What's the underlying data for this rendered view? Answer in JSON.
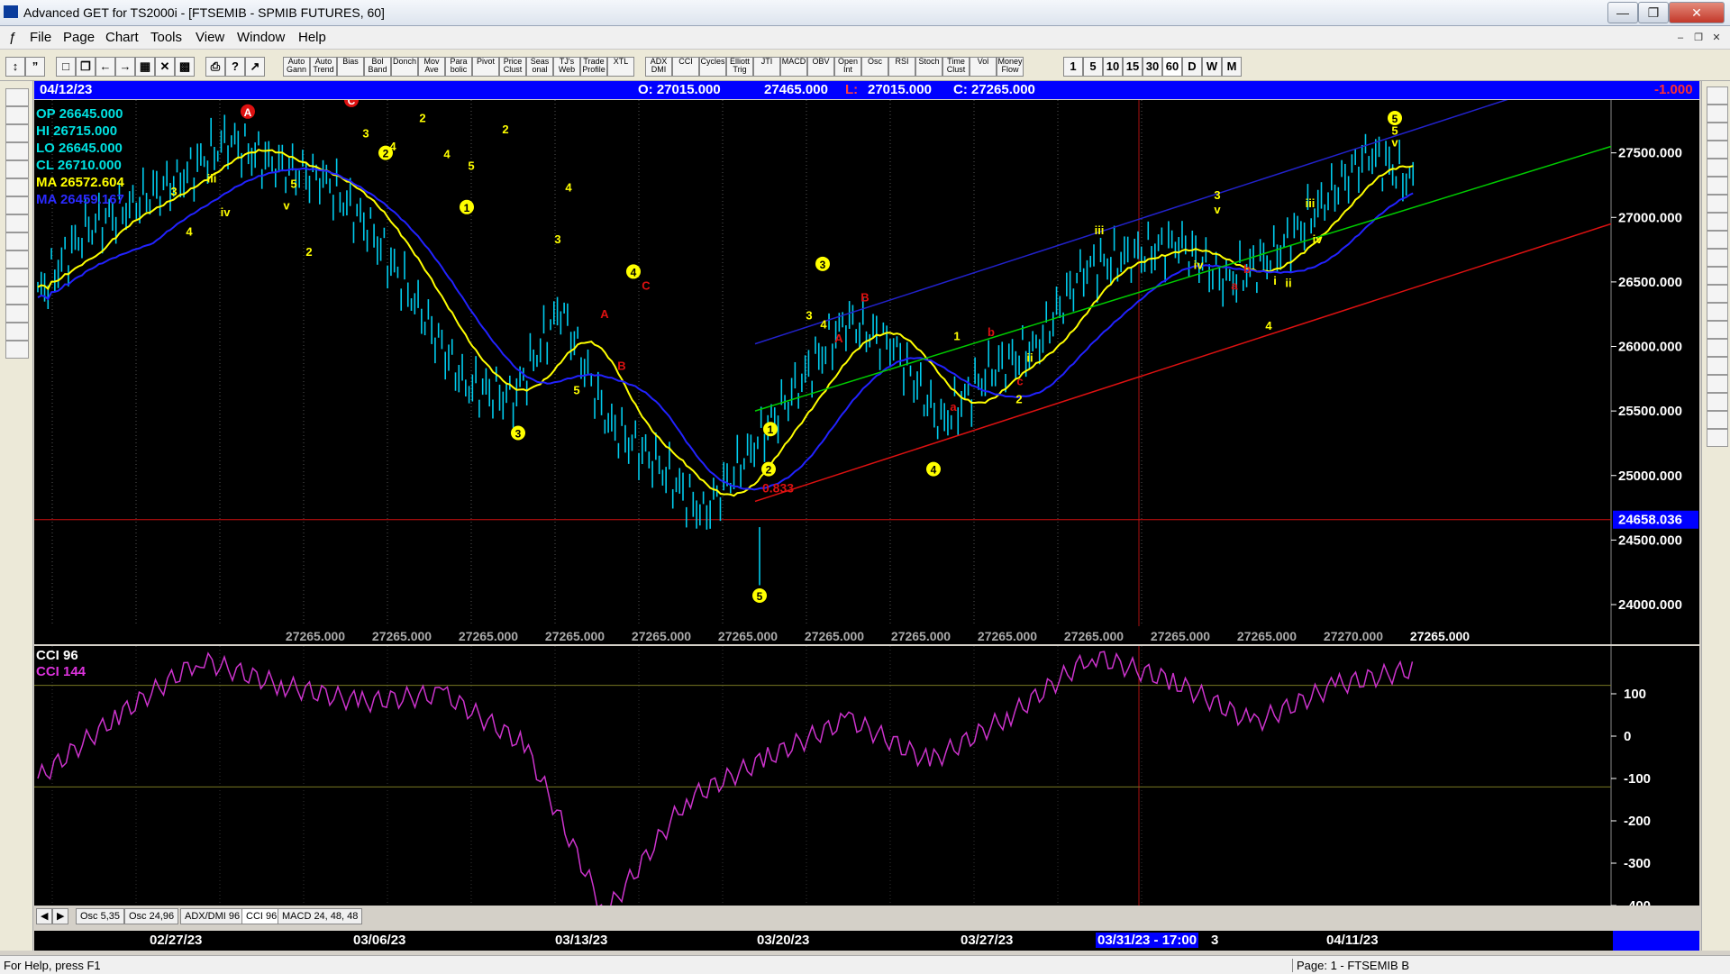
{
  "window": {
    "title": "Advanced GET for TS2000i - [FTSEMIB - SPMIB FUTURES, 60]"
  },
  "menu": [
    "File",
    "Page",
    "Chart",
    "Tools",
    "View",
    "Window",
    "Help"
  ],
  "toolbar": {
    "study_buttons": [
      "Auto Gann",
      "Auto Trend",
      "Bias",
      "Bol Band",
      "Donch",
      "Mov Ave",
      "Para bolic",
      "Pivot",
      "Price Clust",
      "Seas onal",
      "TJ's Web",
      "Trade Profile",
      "XTL",
      "ADX DMI",
      "CCI",
      "Cycles",
      "Elliott Trig",
      "JTI",
      "MACD",
      "OBV",
      "Open Int",
      "Osc",
      "RSI",
      "Stoch",
      "Time Clust",
      "Vol",
      "Money Flow"
    ],
    "intervals": [
      "1",
      "5",
      "10",
      "15",
      "30",
      "60",
      "D",
      "W",
      "M"
    ]
  },
  "chart_header": {
    "date": "04/12/23",
    "open": "O: 27015.000",
    "high": "27465.000",
    "low_label": "L:",
    "low": "27015.000",
    "close": "C: 27265.000",
    "change": "-1.000"
  },
  "ohlc_box": {
    "op": "OP 26645.000",
    "hi": "HI  26715.000",
    "lo": "LO  26645.000",
    "cl": "CL  26710.000",
    "ma": "MA  26572.604",
    "ma2": "MA  26459.167"
  },
  "price_axis": [
    "27500.000",
    "27000.000",
    "26500.000",
    "26000.000",
    "25500.000",
    "25000.000",
    "24500.000",
    "24000.000"
  ],
  "price_marker": "24658.036",
  "retrace_label": "0.833",
  "bottom_values": [
    "27265.000",
    "27265.000",
    "27265.000",
    "27265.000",
    "27265.000",
    "27265.000",
    "27265.000",
    "27265.000",
    "27265.000",
    "27265.000",
    "27265.000",
    "27265.000",
    "27270.000",
    "27265.000"
  ],
  "indicator": {
    "title": "CCI 96",
    "subtitle": "CCI  144",
    "axis": [
      "100",
      "0",
      "-100",
      "-200",
      "-300",
      "-400"
    ]
  },
  "tabs": [
    "Osc 5,35",
    "Osc 24,96",
    "ADX/DMI 96",
    "CCI 96",
    "MACD 24, 48, 48"
  ],
  "dates": [
    "02/27/23",
    "03/06/23",
    "03/13/23",
    "03/20/23",
    "03/27/23",
    "04/11/23"
  ],
  "cursor_date": "03/31/23 - 17:00",
  "cursor_suffix": "3",
  "status": {
    "left": "For Help, press F1",
    "right": "Page: 1 - FTSEMIB B"
  },
  "colors": {
    "price_bars": "#00ccee",
    "ma_yellow": "#ffff00",
    "ma_blue": "#2222ff",
    "cci": "#cc33cc",
    "header_bg": "#0000ff",
    "upper_channel": "#2222cc",
    "mid_channel": "#00cc00",
    "lower_channel": "#dd1111"
  },
  "chart_data": {
    "type": "line",
    "title": "FTSEMIB - SPMIB FUTURES, 60",
    "x": [
      "02/27/23",
      "03/06/23",
      "03/13/23",
      "03/20/23",
      "03/27/23",
      "04/11/23"
    ],
    "series": [
      {
        "name": "CCI 96",
        "values": [
          -100,
          50,
          180,
          120,
          80,
          100,
          -20,
          -420,
          -150,
          -50,
          40,
          -60,
          50,
          190,
          130,
          30,
          120,
          160
        ]
      }
    ],
    "price_path": [
      26400,
      26900,
      27100,
      27300,
      27600,
      27400,
      27300,
      26900,
      26300,
      25700,
      25600,
      26300,
      25400,
      25100,
      24700,
      25200,
      25700,
      26200,
      26000,
      25400,
      25800,
      26000,
      26600,
      26700,
      26800,
      26500,
      26700,
      27100,
      27500,
      27250
    ],
    "ylim": [
      24000,
      27700
    ]
  }
}
